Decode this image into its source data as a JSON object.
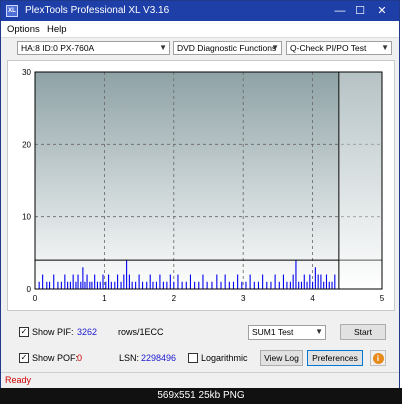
{
  "window": {
    "title": "PlexTools Professional XL V3.16",
    "icon_text": "XL"
  },
  "titlebar_buttons": {
    "minimize": "—",
    "maximize": "☐",
    "close": "✕"
  },
  "menu": {
    "options": "Options",
    "help": "Help"
  },
  "toolbar": {
    "drive": "HA:8 ID:0  PX-760A",
    "function": "DVD Diagnostic Functions",
    "test": "Q-Check PI/PO Test"
  },
  "chart_data": {
    "type": "bar",
    "xlim": [
      0,
      5
    ],
    "ylim": [
      0,
      30
    ],
    "xticks": [
      "0",
      "1",
      "2",
      "3",
      "4",
      "5"
    ],
    "yticks": [
      "0",
      "10",
      "20",
      "30"
    ],
    "threshold": 4,
    "end_marker_x": 4.38,
    "grid": true,
    "bar_color": "#0000ee",
    "x": [
      0.06,
      0.11,
      0.17,
      0.21,
      0.27,
      0.33,
      0.38,
      0.43,
      0.47,
      0.51,
      0.55,
      0.59,
      0.62,
      0.66,
      0.69,
      0.72,
      0.75,
      0.79,
      0.82,
      0.86,
      0.9,
      0.94,
      0.98,
      1.02,
      1.06,
      1.1,
      1.15,
      1.19,
      1.24,
      1.28,
      1.32,
      1.36,
      1.4,
      1.45,
      1.5,
      1.55,
      1.61,
      1.66,
      1.7,
      1.75,
      1.8,
      1.85,
      1.9,
      1.95,
      2.0,
      2.06,
      2.12,
      2.18,
      2.24,
      2.3,
      2.36,
      2.42,
      2.48,
      2.55,
      2.62,
      2.68,
      2.74,
      2.8,
      2.86,
      2.92,
      2.98,
      3.04,
      3.1,
      3.16,
      3.22,
      3.28,
      3.34,
      3.4,
      3.46,
      3.52,
      3.58,
      3.63,
      3.68,
      3.72,
      3.76,
      3.8,
      3.84,
      3.88,
      3.92,
      3.96,
      4.0,
      4.04,
      4.08,
      4.12,
      4.16,
      4.2,
      4.24,
      4.28,
      4.32
    ],
    "values": [
      1,
      2,
      1,
      1,
      2,
      1,
      1,
      2,
      1,
      1,
      2,
      1,
      2,
      1,
      3,
      1,
      2,
      1,
      1,
      2,
      1,
      1,
      2,
      1,
      2,
      1,
      1,
      2,
      1,
      2,
      4,
      2,
      1,
      1,
      2,
      1,
      1,
      2,
      1,
      1,
      2,
      1,
      1,
      2,
      1,
      2,
      1,
      1,
      2,
      1,
      1,
      2,
      1,
      1,
      2,
      1,
      2,
      1,
      1,
      2,
      1,
      1,
      2,
      1,
      1,
      2,
      1,
      1,
      2,
      1,
      2,
      1,
      1,
      2,
      4,
      1,
      1,
      2,
      1,
      2,
      1,
      3,
      2,
      2,
      1,
      2,
      1,
      1,
      2
    ]
  },
  "footer": {
    "show_pif_label": "Show PIF:",
    "pif_value": "3262",
    "rows_label": "rows/1ECC",
    "show_pof_label": "Show POF:",
    "pof_value": "0",
    "lsn_label": "LSN:",
    "lsn_value": "2298496",
    "logarithmic_label": "Logarithmic",
    "sum_select": "SUM1 Test",
    "start_label": "Start",
    "view_log_label": "View Log",
    "preferences_label": "Preferences",
    "info_icon": "i"
  },
  "status": {
    "text": "Ready"
  },
  "caption": {
    "text": "569x551  25kb  PNG"
  }
}
